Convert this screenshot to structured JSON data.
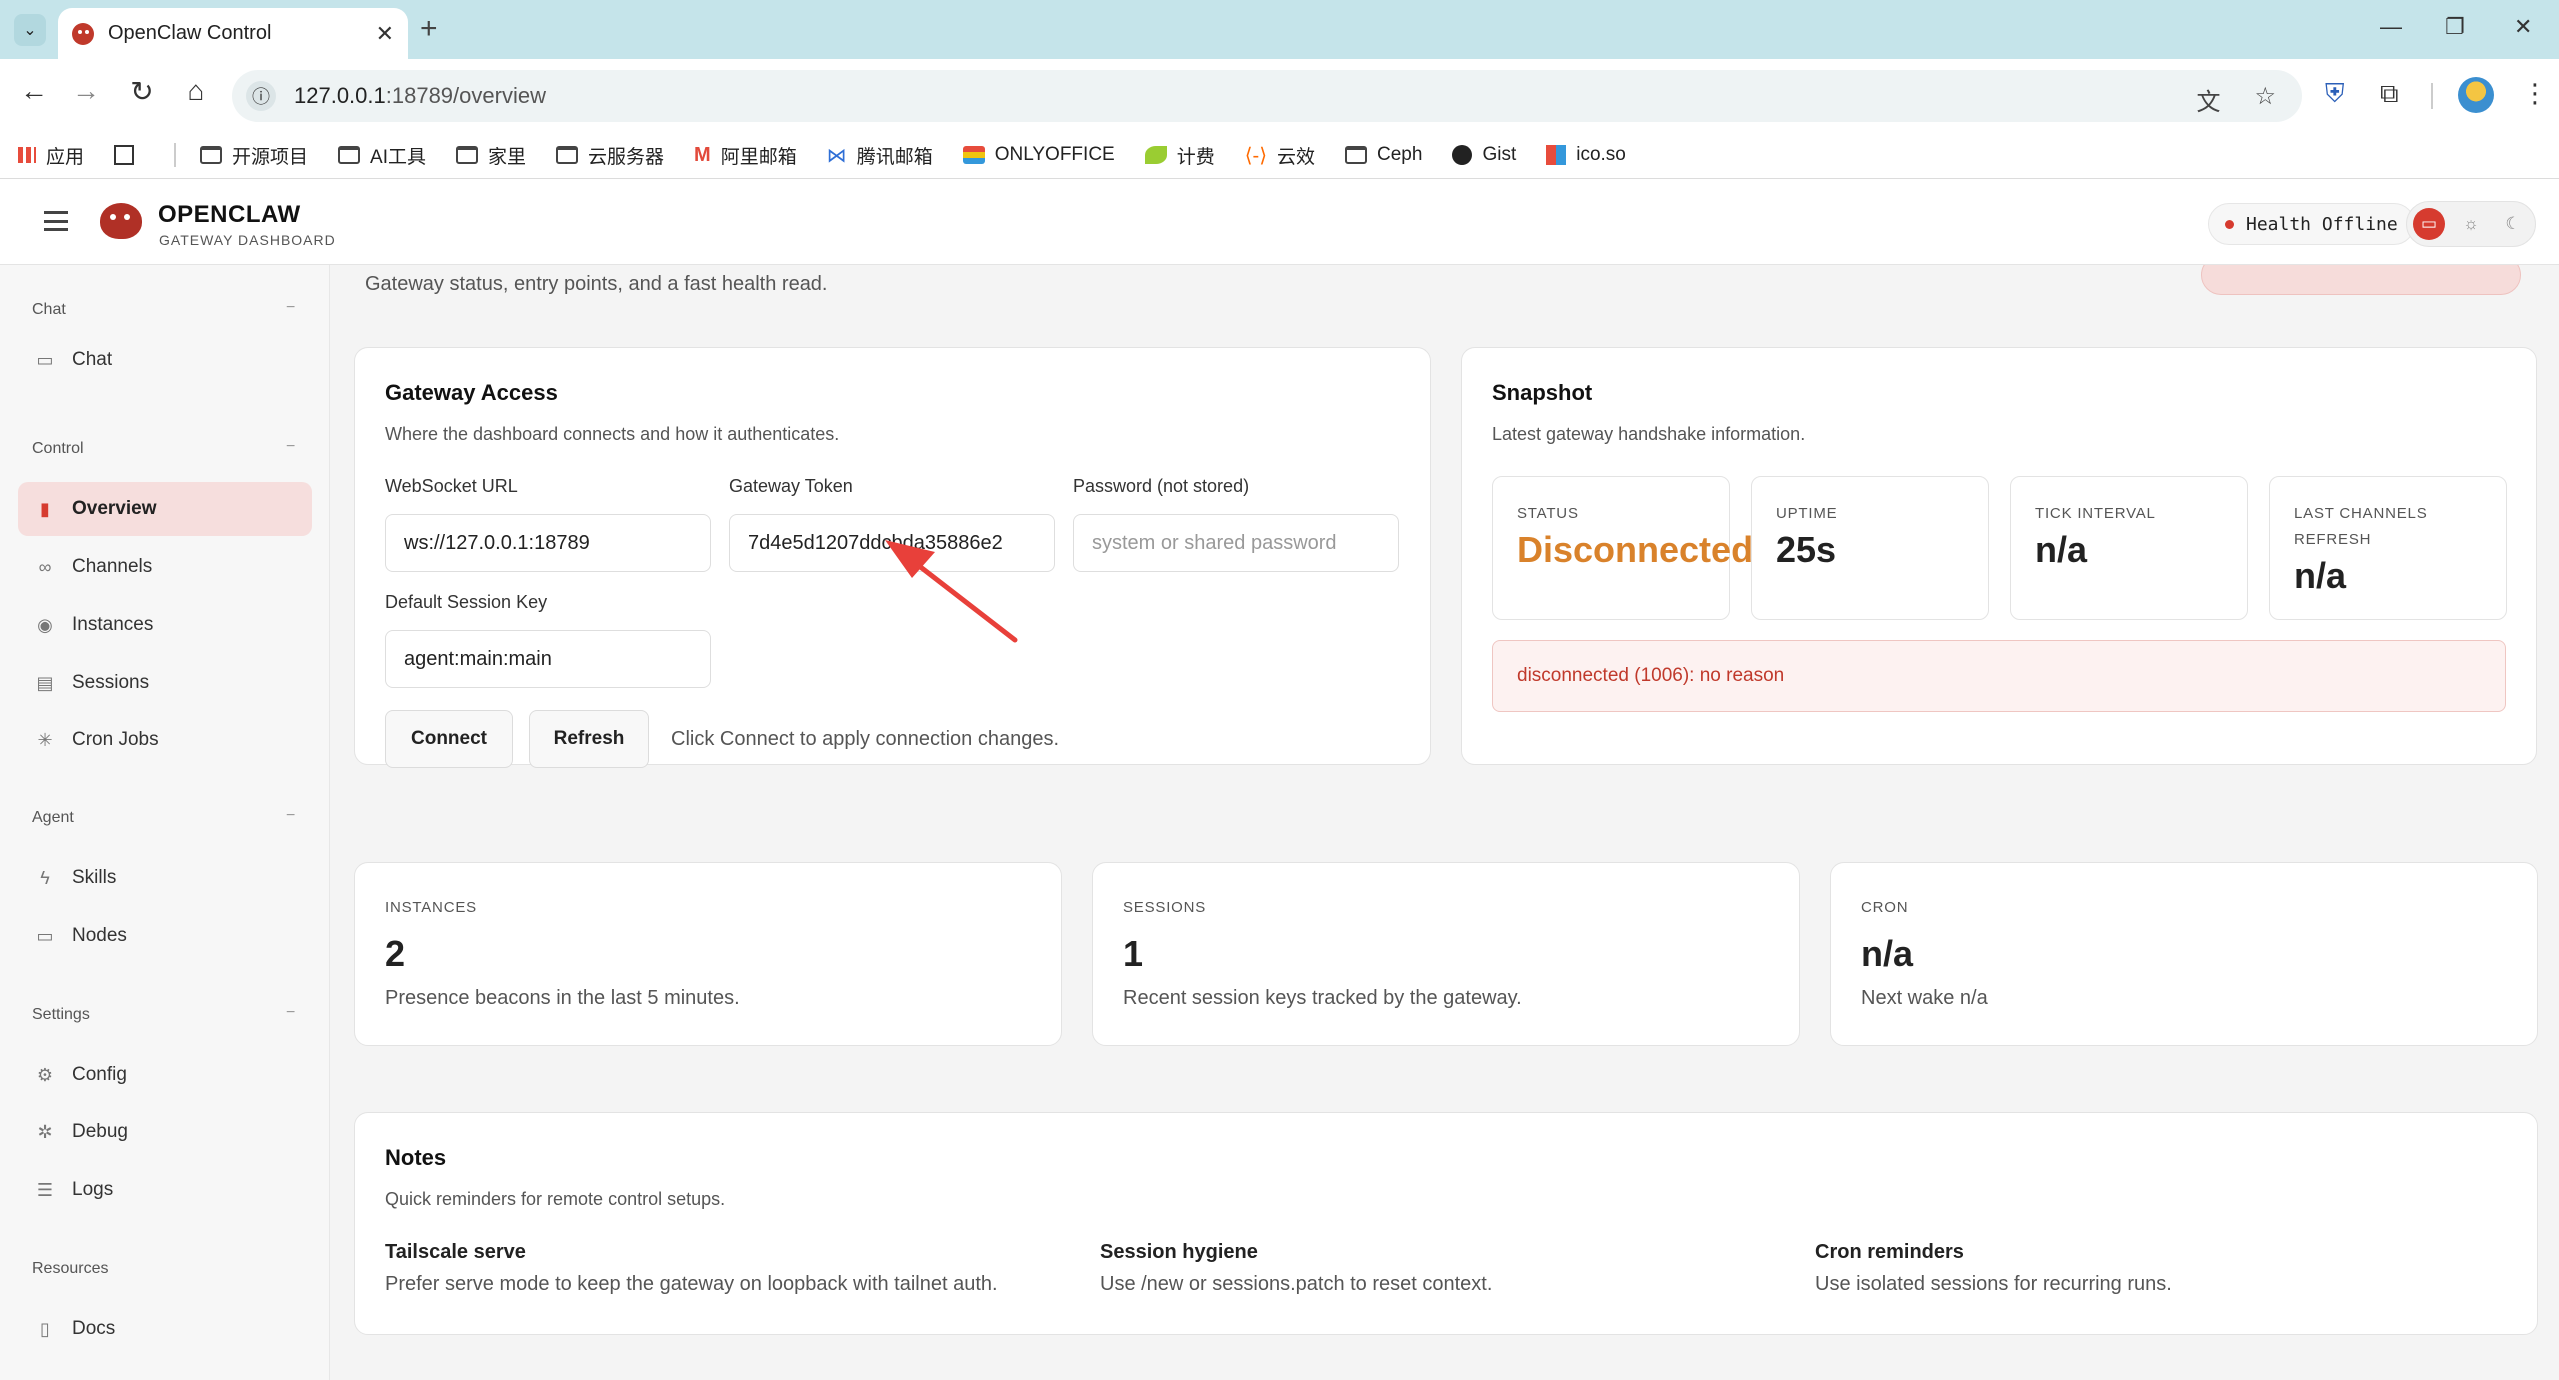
{
  "browser": {
    "tab_title": "OpenClaw Control",
    "tab_close": "✕",
    "new_tab": "+",
    "url_host": "127.0.0.1",
    "url_rest": ":18789/overview",
    "window_controls": [
      "—",
      "❐",
      "✕"
    ],
    "bookmarks": [
      {
        "label": "应用",
        "icon": "apps-grid-icon"
      },
      {
        "label": "",
        "icon": "tab-groups-icon"
      },
      {
        "label": "开源项目",
        "icon": "folder-icon"
      },
      {
        "label": "AI工具",
        "icon": "folder-icon"
      },
      {
        "label": "家里",
        "icon": "folder-icon"
      },
      {
        "label": "云服务器",
        "icon": "folder-icon"
      },
      {
        "label": "阿里邮箱",
        "icon": "mail-icon"
      },
      {
        "label": "腾讯邮箱",
        "icon": "mail-icon"
      },
      {
        "label": "ONLYOFFICE",
        "icon": "onlyoffice-icon"
      },
      {
        "label": "计费",
        "icon": "leaf-icon"
      },
      {
        "label": "云效",
        "icon": "yunxiao-icon"
      },
      {
        "label": "Ceph",
        "icon": "folder-icon"
      },
      {
        "label": "Gist",
        "icon": "github-icon"
      },
      {
        "label": "ico.so",
        "icon": "icoso-icon"
      }
    ]
  },
  "header": {
    "brand_name": "OPENCLAW",
    "brand_sub": "GATEWAY DASHBOARD",
    "health_label": "Health",
    "health_value": "Offline",
    "status_color": "#d63b2f"
  },
  "sidebar": {
    "sections": [
      {
        "title": "Chat",
        "items": [
          {
            "label": "Chat",
            "icon": "chat-bubble-icon"
          }
        ]
      },
      {
        "title": "Control",
        "items": [
          {
            "label": "Overview",
            "icon": "bar-chart-icon",
            "active": true
          },
          {
            "label": "Channels",
            "icon": "link-icon"
          },
          {
            "label": "Instances",
            "icon": "broadcast-icon"
          },
          {
            "label": "Sessions",
            "icon": "document-icon"
          },
          {
            "label": "Cron Jobs",
            "icon": "loader-icon"
          }
        ]
      },
      {
        "title": "Agent",
        "items": [
          {
            "label": "Skills",
            "icon": "lightning-icon"
          },
          {
            "label": "Nodes",
            "icon": "monitor-icon"
          }
        ]
      },
      {
        "title": "Settings",
        "items": [
          {
            "label": "Config",
            "icon": "gear-icon"
          },
          {
            "label": "Debug",
            "icon": "bug-icon"
          },
          {
            "label": "Logs",
            "icon": "logs-icon"
          }
        ]
      },
      {
        "title": "Resources",
        "items": [
          {
            "label": "Docs",
            "icon": "book-icon"
          }
        ]
      }
    ]
  },
  "page": {
    "subtitle": "Gateway status, entry points, and a fast health read."
  },
  "gateway_access": {
    "title": "Gateway Access",
    "subtitle": "Where the dashboard connects and how it authenticates.",
    "ws_label": "WebSocket URL",
    "ws_value": "ws://127.0.0.1:18789",
    "token_label": "Gateway Token",
    "token_value": "7d4e5d1207ddcbda35886e2",
    "password_label": "Password (not stored)",
    "password_placeholder": "system or shared password",
    "session_key_label": "Default Session Key",
    "session_key_value": "agent:main:main",
    "connect_label": "Connect",
    "refresh_label": "Refresh",
    "hint": "Click Connect to apply connection changes."
  },
  "snapshot": {
    "title": "Snapshot",
    "subtitle": "Latest gateway handshake information.",
    "stats": [
      {
        "label": "STATUS",
        "value": "Disconnected",
        "warn": true
      },
      {
        "label": "UPTIME",
        "value": "25s"
      },
      {
        "label": "TICK INTERVAL",
        "value": "n/a"
      },
      {
        "label": "LAST CHANNELS REFRESH",
        "value": "n/a"
      }
    ],
    "alert": "disconnected (1006): no reason",
    "warn_color": "#d9822b"
  },
  "metrics": [
    {
      "label": "INSTANCES",
      "value": "2",
      "sub": "Presence beacons in the last 5 minutes."
    },
    {
      "label": "SESSIONS",
      "value": "1",
      "sub": "Recent session keys tracked by the gateway."
    },
    {
      "label": "CRON",
      "value": "n/a",
      "sub": "Next wake n/a"
    }
  ],
  "notes": {
    "title": "Notes",
    "subtitle": "Quick reminders for remote control setups.",
    "items": [
      {
        "title": "Tailscale serve",
        "text": "Prefer serve mode to keep the gateway on loopback with tailnet auth."
      },
      {
        "title": "Session hygiene",
        "text": "Use /new or sessions.patch to reset context."
      },
      {
        "title": "Cron reminders",
        "text": "Use isolated sessions for recurring runs."
      }
    ]
  }
}
